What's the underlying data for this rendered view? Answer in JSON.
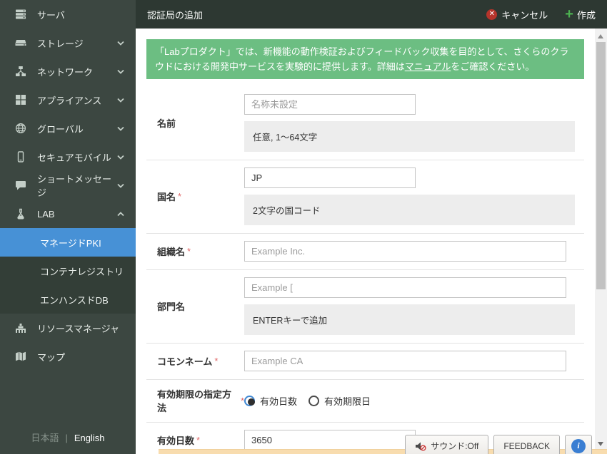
{
  "header": {
    "title": "認証局の追加",
    "cancel_label": "キャンセル",
    "create_label": "作成"
  },
  "sidebar": {
    "items": [
      {
        "label": "サーバ",
        "icon": "server-icon",
        "chevron": ""
      },
      {
        "label": "ストレージ",
        "icon": "storage-icon",
        "chevron": "down"
      },
      {
        "label": "ネットワーク",
        "icon": "network-icon",
        "chevron": "down"
      },
      {
        "label": "アプライアンス",
        "icon": "appliance-icon",
        "chevron": "down"
      },
      {
        "label": "グローバル",
        "icon": "globe-icon",
        "chevron": "down"
      },
      {
        "label": "セキュアモバイル",
        "icon": "mobile-icon",
        "chevron": "down"
      },
      {
        "label": "ショートメッセージ",
        "icon": "message-icon",
        "chevron": "down"
      },
      {
        "label": "LAB",
        "icon": "lab-icon",
        "chevron": "up"
      }
    ],
    "submenu": [
      {
        "label": "マネージドPKI",
        "selected": true
      },
      {
        "label": "コンテナレジストリ",
        "selected": false
      },
      {
        "label": "エンハンスドDB",
        "selected": false
      }
    ],
    "items_bottom": [
      {
        "label": "リソースマネージャ",
        "icon": "resource-manager-icon"
      },
      {
        "label": "マップ",
        "icon": "map-icon"
      }
    ],
    "language": {
      "ja": "日本語",
      "sep": "|",
      "en": "English"
    }
  },
  "banner": {
    "text_before": "「Labプロダクト」では、新機能の動作検証およびフィードバック収集を目的として、さくらのクラウドにおける開発中サービスを実験的に提供します。詳細は",
    "link_text": "マニュアル",
    "text_after": "をご確認ください。"
  },
  "form": {
    "rows": [
      {
        "label": "名前",
        "required": false,
        "type": "text",
        "value": "",
        "placeholder": "名称未設定",
        "size": "narrow",
        "help": "任意, 1～64文字"
      },
      {
        "label": "国名",
        "required": true,
        "type": "text",
        "value": "JP",
        "placeholder": "",
        "size": "narrow",
        "help": "2文字の国コード"
      },
      {
        "label": "組織名",
        "required": true,
        "type": "text",
        "value": "",
        "placeholder": "Example Inc.",
        "size": "wide",
        "help": ""
      },
      {
        "label": "部門名",
        "required": false,
        "type": "text",
        "value": "",
        "placeholder": "Example [",
        "size": "wide",
        "help": "ENTERキーで追加"
      },
      {
        "label": "コモンネーム",
        "required": true,
        "type": "text",
        "value": "",
        "placeholder": "Example CA",
        "size": "wide",
        "help": ""
      },
      {
        "label": "有効期限の指定方法",
        "required": true,
        "type": "radio",
        "options": [
          {
            "label": "有効日数",
            "selected": true
          },
          {
            "label": "有効期限日",
            "selected": false
          }
        ]
      },
      {
        "label": "有効日数",
        "required": true,
        "type": "text",
        "value": "3650",
        "placeholder": "",
        "size": "narrow",
        "help": ""
      }
    ]
  },
  "footer": {
    "sound_label": "サウンド:Off",
    "feedback_label": "FEEDBACK",
    "info_label": "i"
  },
  "colors": {
    "accent_blue": "#4791d6",
    "banner_green": "#6cbe82",
    "cancel_red": "#b5342b",
    "create_green": "#4cb050",
    "sidebar_bg": "#3c4741",
    "header_bg": "#2d3832"
  }
}
